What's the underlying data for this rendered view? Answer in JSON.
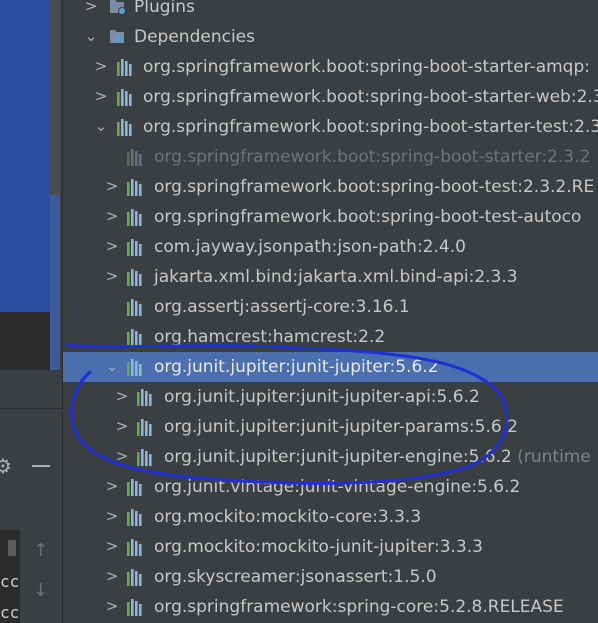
{
  "tree": {
    "plugins_label": "Plugins",
    "dependencies_label": "Dependencies",
    "rows": [
      {
        "label": "org.springframework.boot:spring-boot-starter-amqp:",
        "suffix": ""
      },
      {
        "label": "org.springframework.boot:spring-boot-starter-web:2.3",
        "suffix": ""
      },
      {
        "label": "org.springframework.boot:spring-boot-starter-test:2.3",
        "suffix": ""
      },
      {
        "label": "org.springframework.boot:spring-boot-starter:2.3.2",
        "suffix": ""
      },
      {
        "label": "org.springframework.boot:spring-boot-test:2.3.2.RE",
        "suffix": ""
      },
      {
        "label": "org.springframework.boot:spring-boot-test-autoco",
        "suffix": ""
      },
      {
        "label": "com.jayway.jsonpath:json-path:2.4.0",
        "suffix": ""
      },
      {
        "label": "jakarta.xml.bind:jakarta.xml.bind-api:2.3.3",
        "suffix": ""
      },
      {
        "label": "org.assertj:assertj-core:3.16.1",
        "suffix": ""
      },
      {
        "label": "org.hamcrest:hamcrest:2.2",
        "suffix": ""
      },
      {
        "label": "org.junit.jupiter:junit-jupiter:5.6.2",
        "suffix": ""
      },
      {
        "label": "org.junit.jupiter:junit-jupiter-api:5.6.2",
        "suffix": ""
      },
      {
        "label": "org.junit.jupiter:junit-jupiter-params:5.6.2",
        "suffix": ""
      },
      {
        "label": "org.junit.jupiter:junit-jupiter-engine:5.6.2",
        "suffix": " (runtime"
      },
      {
        "label": "org.junit.vintage:junit-vintage-engine:5.6.2",
        "suffix": ""
      },
      {
        "label": "org.mockito:mockito-core:3.3.3",
        "suffix": ""
      },
      {
        "label": "org.mockito:mockito-junit-jupiter:3.3.3",
        "suffix": ""
      },
      {
        "label": "org.skyscreamer:jsonassert:1.5.0",
        "suffix": ""
      },
      {
        "label": "org.springframework:spring-core:5.2.8.RELEASE",
        "suffix": ""
      }
    ]
  },
  "left_pane": {
    "bottom_text_1": "cc",
    "bottom_text_2": "cc"
  },
  "colors": {
    "selection": "#4b6eaf",
    "annotation": "#1f2fd6"
  }
}
